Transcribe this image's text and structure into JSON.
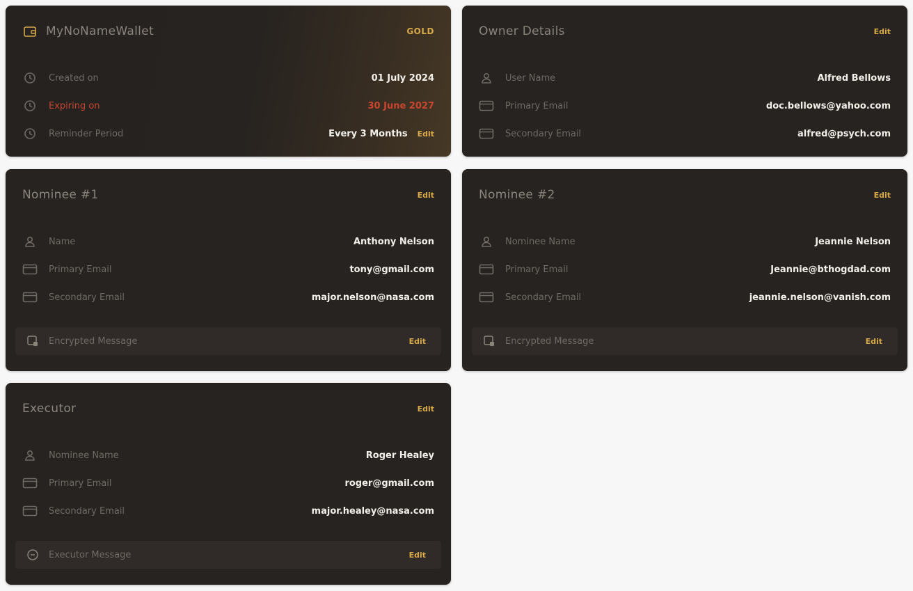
{
  "wallet": {
    "title": "MyNoNameWallet",
    "tier": "GOLD",
    "created_label": "Created on",
    "created_value": "01 July 2024",
    "expiring_label": "Expiring on",
    "expiring_value": "30 June 2027",
    "reminder_label": "Reminder Period",
    "reminder_value": "Every 3 Months",
    "edit_label": "Edit"
  },
  "owner": {
    "title": "Owner Details",
    "edit_label": "Edit",
    "username_label": "User Name",
    "username_value": "Alfred Bellows",
    "primary_label": "Primary Email",
    "primary_value": "doc.bellows@yahoo.com",
    "secondary_label": "Secondary Email",
    "secondary_value": "alfred@psych.com"
  },
  "nominee1": {
    "title": "Nominee #1",
    "edit_label": "Edit",
    "name_label": "Name",
    "name_value": "Anthony Nelson",
    "primary_label": "Primary Email",
    "primary_value": "tony@gmail.com",
    "secondary_label": "Secondary Email",
    "secondary_value": "major.nelson@nasa.com",
    "message_label": "Encrypted Message",
    "message_edit": "Edit"
  },
  "nominee2": {
    "title": "Nominee #2",
    "edit_label": "Edit",
    "name_label": "Nominee Name",
    "name_value": "Jeannie Nelson",
    "primary_label": "Primary Email",
    "primary_value": "Jeannie@bthogdad.com",
    "secondary_label": "Secondary Email",
    "secondary_value": "jeannie.nelson@vanish.com",
    "message_label": "Encrypted Message",
    "message_edit": "Edit"
  },
  "executor": {
    "title": "Executor",
    "edit_label": "Edit",
    "name_label": "Nominee Name",
    "name_value": "Roger Healey",
    "primary_label": "Primary Email",
    "primary_value": "roger@gmail.com",
    "secondary_label": "Secondary Email",
    "secondary_value": "major.healey@nasa.com",
    "message_label": "Executor Message",
    "message_edit": "Edit"
  },
  "colors": {
    "card_bg": "#272320",
    "accent": "#d7a94a",
    "danger": "#c9452f",
    "page_bg": "#f7f7f7"
  }
}
